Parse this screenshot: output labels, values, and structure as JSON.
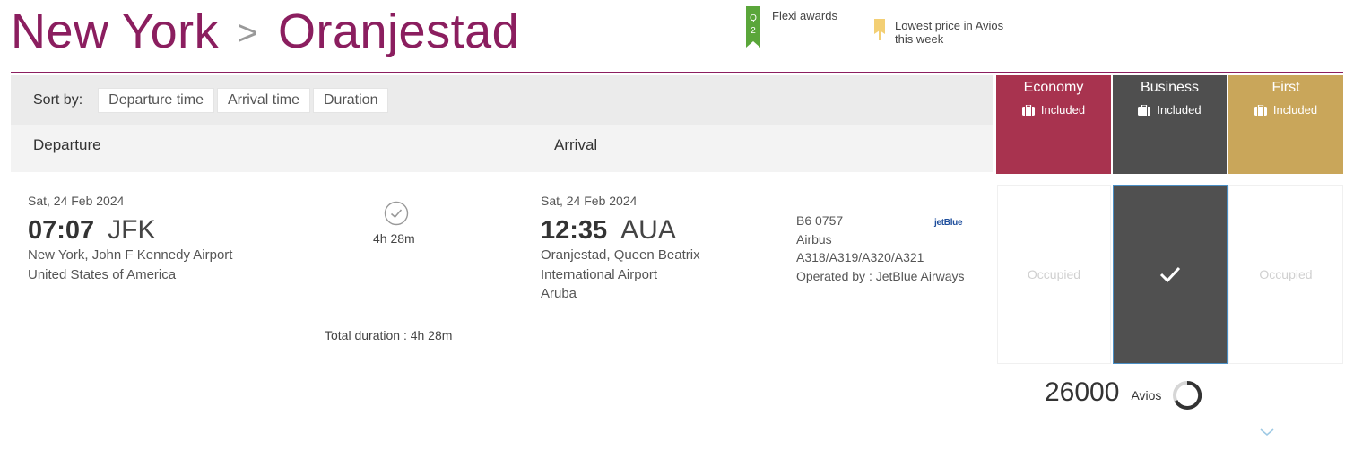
{
  "header": {
    "origin": "New York",
    "separator": ">",
    "destination": "Oranjestad"
  },
  "legend": {
    "flexi_flag_text": "Q2",
    "flexi_label": "Flexi awards",
    "lowest_label_line1": "Lowest price in Avios",
    "lowest_label_line2": "this week"
  },
  "sort": {
    "label": "Sort by:",
    "options": [
      "Departure time",
      "Arrival time",
      "Duration"
    ]
  },
  "columns": {
    "departure": "Departure",
    "arrival": "Arrival"
  },
  "cabins": [
    {
      "name": "Economy",
      "baggage": "Included",
      "color": "#a8334f"
    },
    {
      "name": "Business",
      "baggage": "Included",
      "color": "#4f4f4f"
    },
    {
      "name": "First",
      "baggage": "Included",
      "color": "#c9a65a"
    }
  ],
  "flight": {
    "departure": {
      "date": "Sat, 24 Feb 2024",
      "time": "07:07",
      "code": "JFK",
      "airport_line1": "New York, John F Kennedy Airport",
      "airport_line2": "United States of America"
    },
    "duration": "4h 28m",
    "arrival": {
      "date": "Sat, 24 Feb 2024",
      "time": "12:35",
      "code": "AUA",
      "airport_line1": "Oranjestad, Queen Beatrix",
      "airport_line2": "International Airport",
      "airport_line3": "Aruba"
    },
    "number": "B6 0757",
    "aircraft_line1": "Airbus",
    "aircraft_line2": "A318/A319/A320/A321",
    "operated_by": "Operated by : JetBlue Airways",
    "airline_logo_text": "jetBlue",
    "total_duration": "Total duration : 4h 28m"
  },
  "fares": {
    "economy": "Occupied",
    "business": "selected",
    "first": "Occupied"
  },
  "price": {
    "amount": "26000",
    "unit": "Avios"
  }
}
